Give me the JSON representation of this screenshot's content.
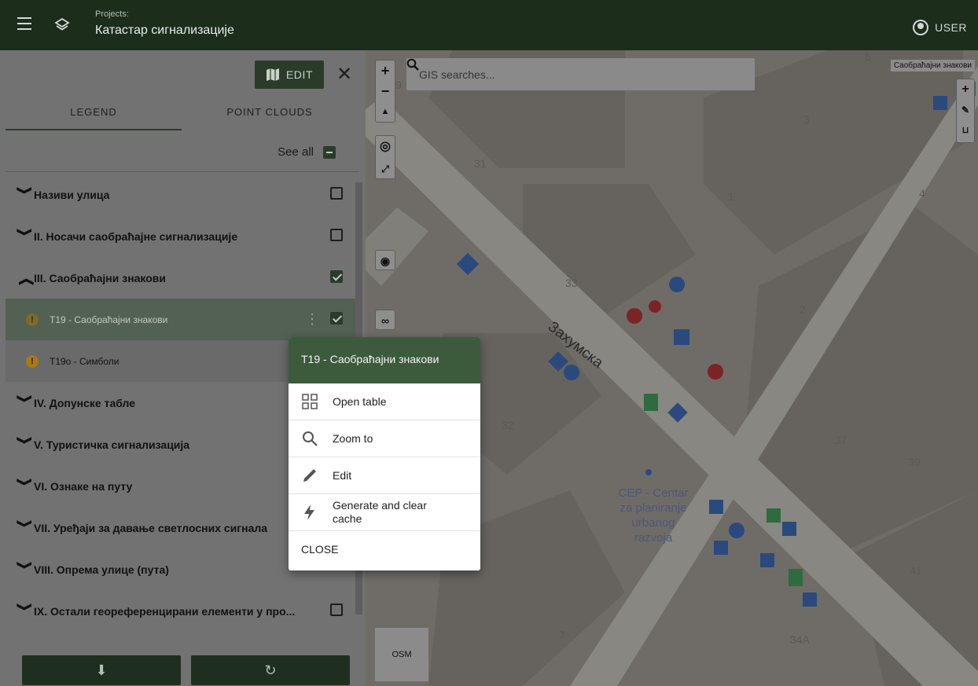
{
  "header": {
    "projects_label": "Projects:",
    "project_name": "Катастар сигнализације",
    "user_label": "USER"
  },
  "sidebar": {
    "edit_label": "EDIT",
    "tabs": [
      {
        "label": "LEGEND",
        "active": true
      },
      {
        "label": "POINT CLOUDS",
        "active": false
      }
    ],
    "see_all_label": "See all",
    "layers": [
      {
        "label": "Називи улица",
        "expanded": false,
        "checked": false
      },
      {
        "label": "II. Носачи саобраћајне сигнализације",
        "expanded": false,
        "checked": false
      },
      {
        "label": "III. Саобраћајни знакови",
        "expanded": true,
        "checked": true
      },
      {
        "label": "T19 - Саобраћајни знакови",
        "sublayer": true,
        "checked": true,
        "selected": true
      },
      {
        "label": "T19о - Симболи",
        "sublayer": true
      },
      {
        "label": "IV. Допунске табле",
        "expanded": false
      },
      {
        "label": "V. Туристичка сигнализација",
        "expanded": false
      },
      {
        "label": "VI. Ознаке на путу",
        "expanded": false
      },
      {
        "label": "VII. Уређаји за давање светлосних сигнала",
        "expanded": false
      },
      {
        "label": "VIII. Опрема улице (пута)",
        "expanded": false
      },
      {
        "label": "IX. Остали геореференцирани елементи у про...",
        "expanded": false,
        "checked": false
      }
    ]
  },
  "map": {
    "search_placeholder": "GIS searches...",
    "basemap_label": "OSM",
    "layer_tooltip": "Саобраћајни знакови",
    "street_name": "Захумска",
    "poi_label": [
      "CEP - Centar",
      "za planiranje",
      "urbanog",
      "razvoja"
    ],
    "house_numbers": [
      "9",
      "5",
      "3",
      "31",
      "1",
      "4",
      "33",
      "2",
      "32",
      "37",
      "39",
      "41",
      "7",
      "34A"
    ]
  },
  "popup": {
    "title": "T19 - Саобраћајни знакови",
    "items": [
      {
        "label": "Open table",
        "icon": "table-icon"
      },
      {
        "label": "Zoom to",
        "icon": "search-icon"
      },
      {
        "label": "Edit",
        "icon": "pencil-icon"
      },
      {
        "label": "Generate and clear cache",
        "icon": "bolt-icon"
      }
    ],
    "close_label": "CLOSE"
  },
  "colors": {
    "header_bg": "#1c2d1c",
    "accent": "#2a3b2a",
    "popup_header": "#3c5a3c"
  }
}
